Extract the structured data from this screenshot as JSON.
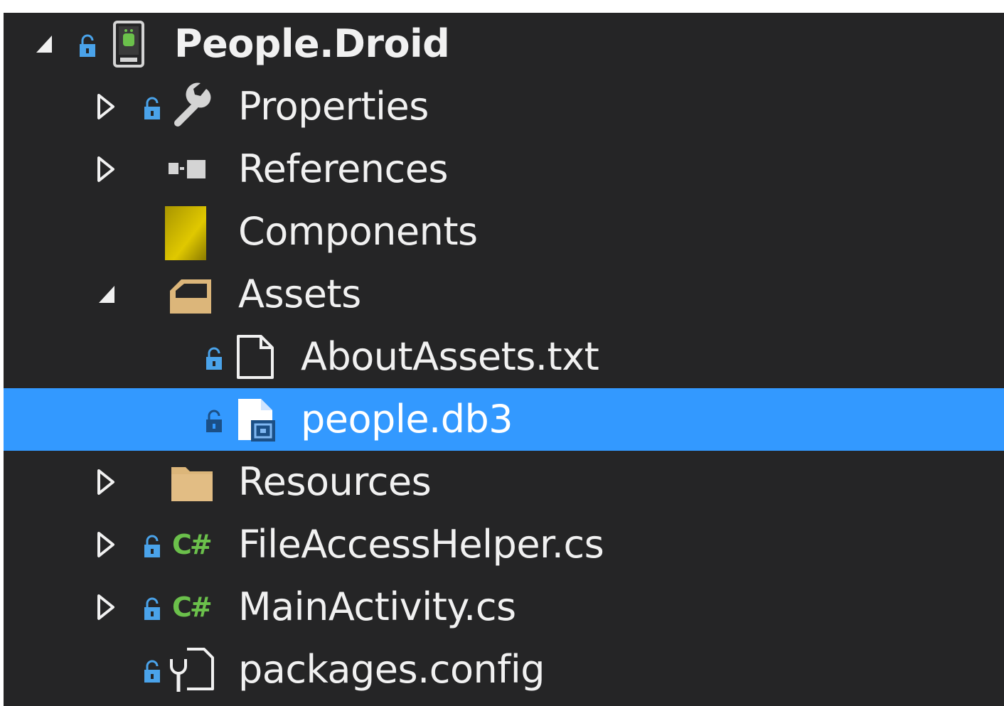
{
  "solution_explorer": {
    "project": {
      "label": "People.Droid",
      "expanded": true
    },
    "items": [
      {
        "label": "Properties",
        "icon": "wrench-icon",
        "expander": "collapsed"
      },
      {
        "label": "References",
        "icon": "references-icon",
        "expander": "collapsed"
      },
      {
        "label": "Components",
        "icon": "components-icon",
        "expander": "none"
      },
      {
        "label": "Assets",
        "icon": "open-folder-icon",
        "expander": "expanded"
      },
      {
        "label": "AboutAssets.txt",
        "icon": "file-icon",
        "expander": "none"
      },
      {
        "label": "people.db3",
        "icon": "database-file-icon",
        "expander": "none",
        "selected": true
      },
      {
        "label": "Resources",
        "icon": "folder-icon",
        "expander": "collapsed"
      },
      {
        "label": "FileAccessHelper.cs",
        "icon": "csharp-icon",
        "icon_text": "C#",
        "expander": "collapsed"
      },
      {
        "label": "MainActivity.cs",
        "icon": "csharp-icon",
        "icon_text": "C#",
        "expander": "collapsed"
      },
      {
        "label": "packages.config",
        "icon": "config-file-icon",
        "expander": "none"
      }
    ]
  },
  "colors": {
    "background": "#252526",
    "text": "#f1f1f1",
    "selection": "#3399ff",
    "selected_text": "#ffffff",
    "lock": "#4aa3ea",
    "folder": "#dcb67a",
    "components": "#c8b400",
    "csharp": "#6bc04b"
  }
}
